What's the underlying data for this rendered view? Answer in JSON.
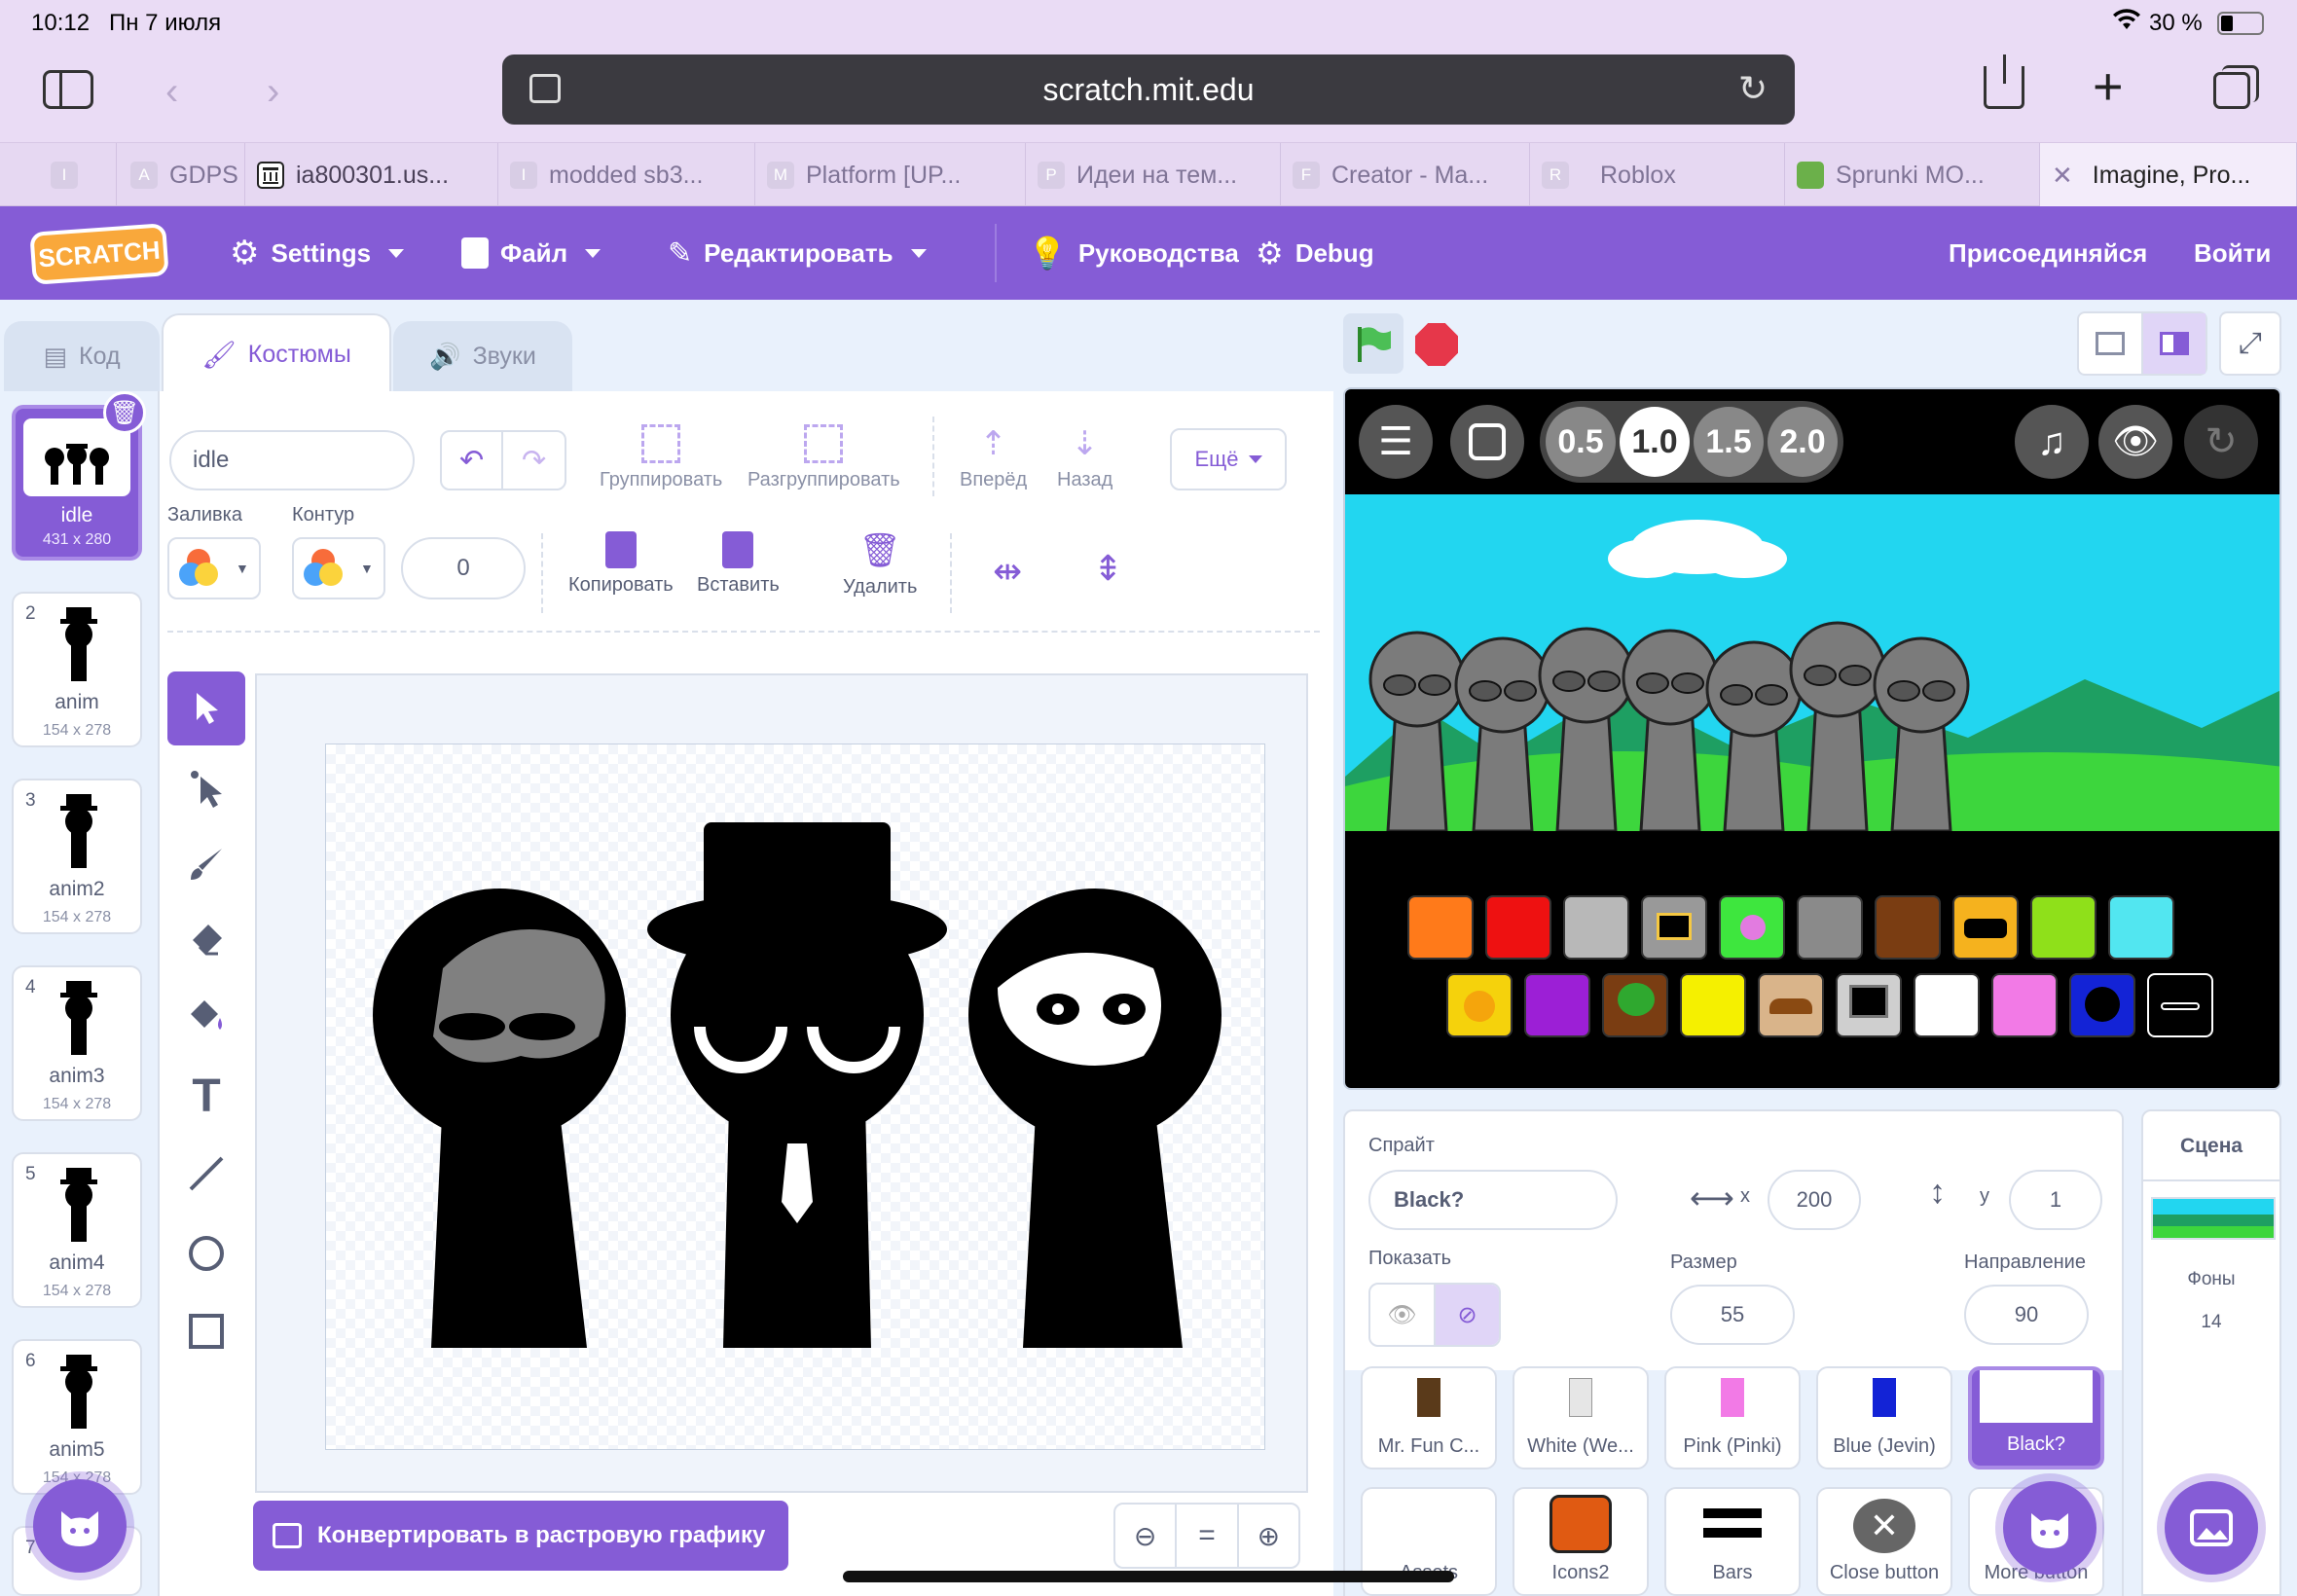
{
  "status": {
    "time": "10:12",
    "date": "Пн 7 июля",
    "battery": "30 %"
  },
  "browser": {
    "url": "scratch.mit.edu"
  },
  "tabs": [
    {
      "fav": "I",
      "label": ""
    },
    {
      "fav": "A",
      "label": "GDPS"
    },
    {
      "fav": "",
      "label": "ia800301.us..."
    },
    {
      "fav": "I",
      "label": "modded sb3..."
    },
    {
      "fav": "M",
      "label": "Platform [UP..."
    },
    {
      "fav": "P",
      "label": "Идеи на тем..."
    },
    {
      "fav": "F",
      "label": "Creator - Ma..."
    },
    {
      "fav": "R",
      "label": "Roblox"
    },
    {
      "fav": "",
      "label": "Sprunki MO..."
    },
    {
      "fav": "",
      "label": "Imagine, Pro..."
    }
  ],
  "menubar": {
    "logo": "SCRATCH",
    "settings": "Settings",
    "file": "Файл",
    "edit": "Редактировать",
    "tutorials": "Руководства",
    "debug": "Debug",
    "join": "Присоединяйся",
    "signin": "Войти"
  },
  "editor_tabs": {
    "code": "Код",
    "costumes": "Костюмы",
    "sounds": "Звуки"
  },
  "costumes": [
    {
      "num": "1",
      "name": "idle",
      "size": "431 x 280"
    },
    {
      "num": "2",
      "name": "anim",
      "size": "154 x 278"
    },
    {
      "num": "3",
      "name": "anim2",
      "size": "154 x 278"
    },
    {
      "num": "4",
      "name": "anim3",
      "size": "154 x 278"
    },
    {
      "num": "5",
      "name": "anim4",
      "size": "154 x 278"
    },
    {
      "num": "6",
      "name": "anim5",
      "size": "154 x 278"
    },
    {
      "num": "7",
      "name": "",
      "size": ""
    }
  ],
  "paint": {
    "costume_name": "idle",
    "group": "Группировать",
    "ungroup": "Разгруппировать",
    "forward": "Вперёд",
    "backward": "Назад",
    "more": "Ещё",
    "fill": "Заливка",
    "outline": "Контур",
    "outline_width": "0",
    "copy": "Копировать",
    "paste": "Вставить",
    "delete": "Удалить",
    "convert": "Конвертировать в растровую графику",
    "zoom_reset": "="
  },
  "stage": {
    "speeds": [
      "0.5",
      "1.0",
      "1.5",
      "2.0"
    ]
  },
  "sprite_info": {
    "sprite_label": "Спрайт",
    "sprite_name": "Black?",
    "x_label": "x",
    "x": "200",
    "y_label": "y",
    "y": "1",
    "show_label": "Показать",
    "size_label": "Размер",
    "size": "55",
    "direction_label": "Направление",
    "direction": "90"
  },
  "stage_panel": {
    "title": "Сцена",
    "backdrops_label": "Фоны",
    "backdrops_count": "14"
  },
  "sprites": [
    {
      "name": "Mr. Fun C..."
    },
    {
      "name": "White (We..."
    },
    {
      "name": "Pink (Pinki)"
    },
    {
      "name": "Blue (Jevin)"
    },
    {
      "name": "Black?"
    },
    {
      "name": "Assets"
    },
    {
      "name": "Icons2"
    },
    {
      "name": "Bars"
    },
    {
      "name": "Close button"
    },
    {
      "name": "More button"
    }
  ],
  "colors": {
    "scratch_purple": "#855cd6",
    "selected_blue": "#855cd6",
    "stage_sky": "#1ed5ee",
    "grass": "#3dd63d"
  },
  "character_tiles_row1": [
    "orange",
    "red",
    "silver",
    "gray-box",
    "green-flower",
    "gray-cat",
    "brown-bucket",
    "yellow-visor",
    "lime-spiky",
    "cyan-frog"
  ],
  "character_tiles_row2": [
    "yellow-sun",
    "purple-horns",
    "brown-tree",
    "yellow-lamps",
    "tan-hat",
    "monitor",
    "white-envelope",
    "pink-bow",
    "blue-dark",
    "black-hat"
  ]
}
